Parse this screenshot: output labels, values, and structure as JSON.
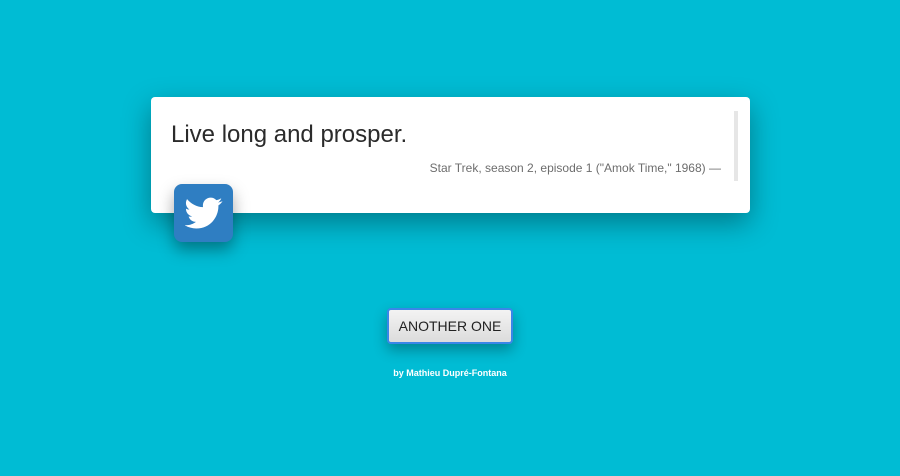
{
  "quote": {
    "text": "Live long and prosper.",
    "attribution": "Star Trek, season 2, episode 1 (\"Amok Time,\" 1968) —"
  },
  "actions": {
    "tweet_icon": "twitter-bird-icon",
    "another_label": "ANOTHER ONE"
  },
  "footer": {
    "credit": "by Mathieu Dupré-Fontana"
  },
  "colors": {
    "background": "#00bcd4",
    "card": "#ffffff",
    "tweet_button": "#2f7ec2",
    "button_focus_border": "#3a86e8"
  }
}
